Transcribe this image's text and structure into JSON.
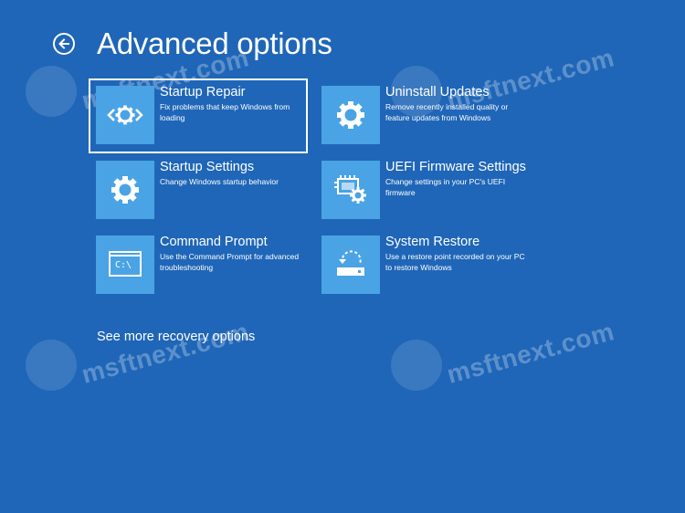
{
  "header": {
    "back_icon": "arrow-left-circle-icon",
    "title": "Advanced options"
  },
  "tiles": [
    {
      "title": "Startup Repair",
      "desc": "Fix problems that keep Windows from loading",
      "icon": "code-gear-icon",
      "selected": true
    },
    {
      "title": "Uninstall Updates",
      "desc": "Remove recently installed quality or feature updates from Windows",
      "icon": "gear-icon",
      "selected": false
    },
    {
      "title": "Startup Settings",
      "desc": "Change Windows startup behavior",
      "icon": "gear-icon",
      "selected": false
    },
    {
      "title": "UEFI Firmware Settings",
      "desc": "Change settings in your PC's UEFI firmware",
      "icon": "chip-gear-icon",
      "selected": false
    },
    {
      "title": "Command Prompt",
      "desc": "Use the Command Prompt for advanced troubleshooting",
      "icon": "command-prompt-icon",
      "selected": false
    },
    {
      "title": "System Restore",
      "desc": "Use a restore point recorded on your PC to restore Windows",
      "icon": "restore-icon",
      "selected": false
    }
  ],
  "more_link": "See more recovery options",
  "cmd_glyph": "C:\\",
  "watermark": "msftnext.com",
  "colors": {
    "background": "#1f66b8",
    "icon_tile": "#4aa3e4",
    "text": "#ffffff"
  }
}
